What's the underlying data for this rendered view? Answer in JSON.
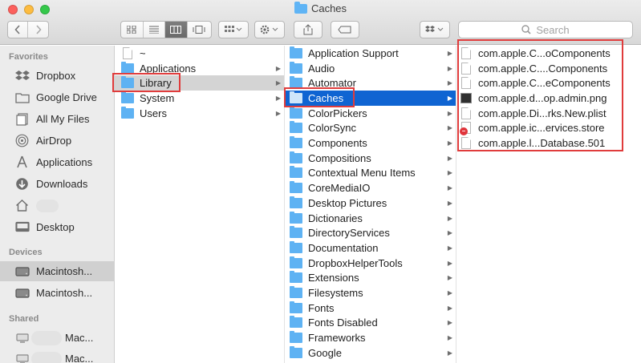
{
  "window": {
    "title": "Caches"
  },
  "toolbar": {
    "back_icon": "chevron-left-icon",
    "forward_icon": "chevron-right-icon",
    "view_modes": [
      "icon-view",
      "list-view",
      "column-view",
      "cover-flow-view"
    ],
    "active_view": "column-view",
    "search_placeholder": "Search"
  },
  "sidebar": {
    "sections": [
      {
        "header": "Favorites",
        "items": [
          "Dropbox",
          "Google Drive",
          "All My Files",
          "AirDrop",
          "Applications",
          "Downloads",
          "",
          "Desktop"
        ]
      },
      {
        "header": "Devices",
        "items": [
          "Macintosh...",
          "Macintosh..."
        ]
      },
      {
        "header": "Shared",
        "items": [
          "Mac...",
          "Mac..."
        ]
      }
    ]
  },
  "columns": {
    "col1": [
      {
        "label": "~",
        "icon": "document-icon"
      },
      {
        "label": "Applications",
        "icon": "applications-folder-icon"
      },
      {
        "label": "Library",
        "icon": "library-folder-icon",
        "selected": true
      },
      {
        "label": "System",
        "icon": "system-folder-icon"
      },
      {
        "label": "Users",
        "icon": "users-folder-icon"
      }
    ],
    "col2": [
      "Application Support",
      "Audio",
      "Automator",
      "Caches",
      "ColorPickers",
      "ColorSync",
      "Components",
      "Compositions",
      "Contextual Menu Items",
      "CoreMediaIO",
      "Desktop Pictures",
      "Dictionaries",
      "DirectoryServices",
      "Documentation",
      "DropboxHelperTools",
      "Extensions",
      "Filesystems",
      "Fonts",
      "Fonts Disabled",
      "Frameworks",
      "Google"
    ],
    "col2_selected": "Caches",
    "col3": [
      {
        "label": "com.apple.C...oComponents",
        "icon": "document-icon"
      },
      {
        "label": "com.apple.C....Components",
        "icon": "document-icon"
      },
      {
        "label": "com.apple.C...eComponents",
        "icon": "document-icon"
      },
      {
        "label": "com.apple.d...op.admin.png",
        "icon": "image-icon"
      },
      {
        "label": "com.apple.Di...rks.New.plist",
        "icon": "document-icon"
      },
      {
        "label": "com.apple.ic...ervices.store",
        "icon": "store-file-icon"
      },
      {
        "label": "com.apple.l...Database.501",
        "icon": "document-icon"
      }
    ]
  },
  "colors": {
    "selection_blue": "#0f64d2",
    "highlight_red": "#e03c3c",
    "folder_blue": "#5eb2f3"
  }
}
